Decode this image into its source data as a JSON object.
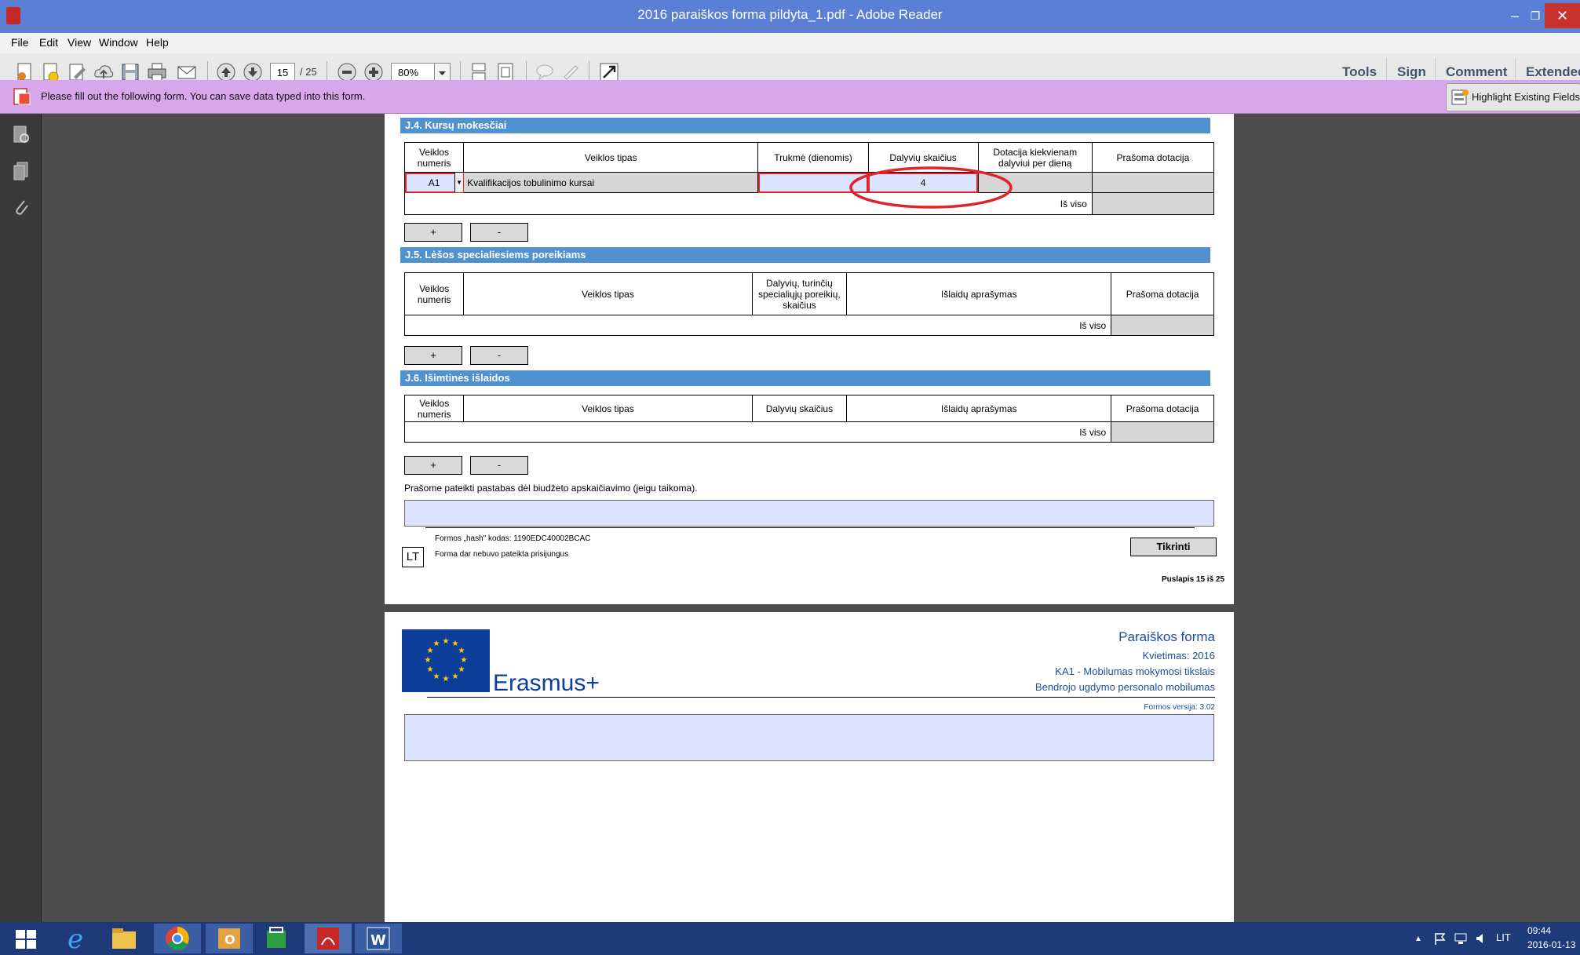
{
  "window": {
    "title": "2016 paraiškos forma pildyta_1.pdf - Adobe Reader",
    "minimize": "–",
    "restore": "❐",
    "close": "✕"
  },
  "menu": [
    "File",
    "Edit",
    "View",
    "Window",
    "Help"
  ],
  "toolbar": {
    "page_current": "15",
    "page_total": "/ 25",
    "zoom": "80%",
    "right_links": [
      "Tools",
      "Sign",
      "Comment",
      "Extended"
    ]
  },
  "formbar": {
    "message": "Please fill out the following form. You can save data typed into this form.",
    "highlight_button": "Highlight Existing Fields"
  },
  "page15": {
    "j4": {
      "title": "J.4. Kursų mokesčiai",
      "headers": [
        "Veiklos numeris",
        "Veiklos tipas",
        "Trukmė (dienomis)",
        "Dalyvių skaičius",
        "Dotacija kiekvienam dalyviui per dieną",
        "Prašoma dotacija"
      ],
      "row": {
        "number": "A1",
        "type": "Kvalifikacijos tobulinimo kursai",
        "duration": "",
        "participants": "4",
        "per_day": "",
        "requested": ""
      },
      "total_label": "Iš viso"
    },
    "j5": {
      "title": "J.5. Lėšos specialiesiems poreikiams",
      "headers": [
        "Veiklos numeris",
        "Veiklos tipas",
        "Dalyvių, turinčių specialiųjų poreikių, skaičius",
        "Išlaidų aprašymas",
        "Prašoma dotacija"
      ],
      "total_label": "Iš viso"
    },
    "j6": {
      "title": "J.6. Išimtinės išlaidos",
      "headers": [
        "Veiklos numeris",
        "Veiklos tipas",
        "Dalyvių skaičius",
        "Išlaidų aprašymas",
        "Prašoma dotacija"
      ],
      "total_label": "Iš viso"
    },
    "plus": "+",
    "minus": "-",
    "notes_label": "Prašome pateikti pastabas dėl biudžeto apskaičiavimo (jeigu taikoma).",
    "hash": "Formos „hash\" kodas: 1190EDC40002BCAC",
    "submitted": "Forma dar nebuvo pateikta prisijungus",
    "lang": "LT",
    "check_button": "Tikrinti",
    "page_label": "Puslapis 15 iš 25"
  },
  "page16": {
    "brand": "Erasmus+",
    "lines": [
      "Paraiškos forma",
      "Kvietimas: 2016",
      "KA1 - Mobilumas mokymosi tikslais",
      "Bendrojo ugdymo personalo mobilumas"
    ],
    "version": "Formos versija: 3.02"
  },
  "taskbar": {
    "lang": "LIT",
    "time": "09:44",
    "date": "2016-01-13"
  },
  "colors": {
    "titlebar": "#5b7fd4",
    "formbar": "#d7a6eb",
    "section": "#4f92cf",
    "field": "#dbe3ff",
    "annotation": "#e0242c",
    "taskbar": "#1e3a78"
  }
}
